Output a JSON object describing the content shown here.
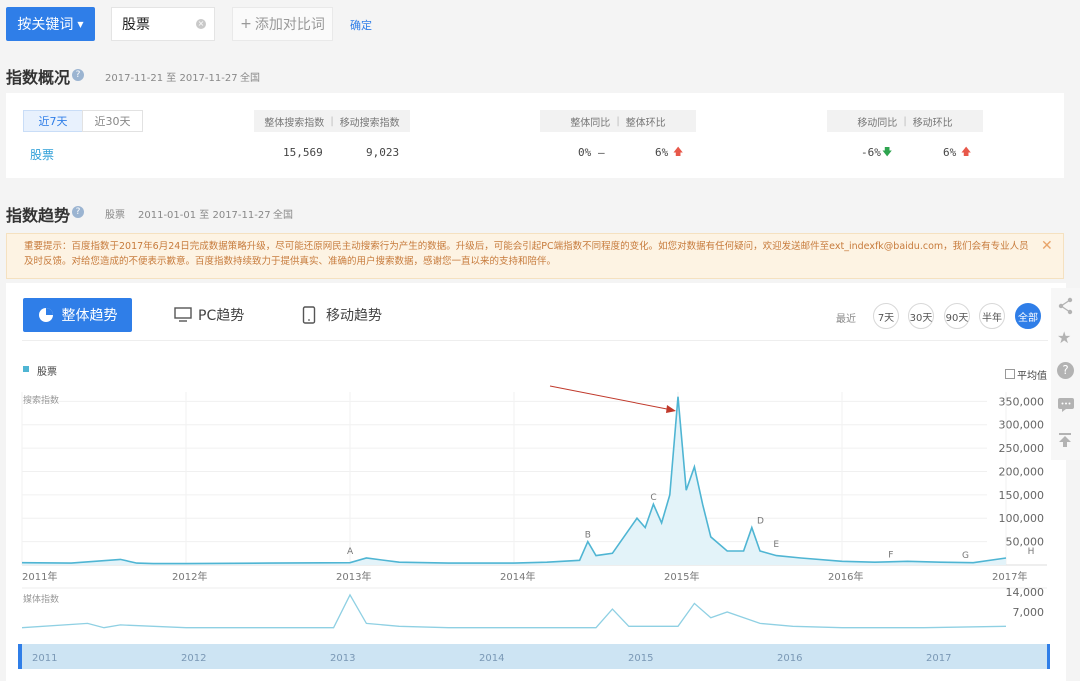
{
  "topbar": {
    "keyword_button": "按关键词",
    "keyword_value": "股票",
    "add_compare": "添加对比词",
    "confirm": "确定"
  },
  "overview": {
    "title": "指数概况",
    "date_range": "2017-11-21 至 2017-11-27",
    "region": "全国",
    "tabs": [
      "近7天",
      "近30天"
    ],
    "headers": {
      "search": [
        "整体搜索指数",
        "移动搜索指数"
      ],
      "overall": [
        "整体同比",
        "整体环比"
      ],
      "mobile": [
        "移动同比",
        "移动环比"
      ]
    },
    "row": {
      "keyword": "股票",
      "overall_search": "15,569",
      "mobile_search": "9,023",
      "overall_yoy": "0%",
      "overall_yoy_trend": "–",
      "overall_mom": "6%",
      "mobile_yoy": "-6%",
      "mobile_mom": "6%"
    }
  },
  "trend": {
    "title": "指数趋势",
    "keyword": "股票",
    "date_range": "2011-01-01 至 2017-11-27",
    "region": "全国",
    "notice": "重要提示：百度指数于2017年6月24日完成数据策略升级，尽可能还原网民主动搜索行为产生的数据。升级后，可能会引起PC端指数不同程度的变化。如您对数据有任何疑问，欢迎发送邮件至ext_indexfk@baidu.com，我们会有专业人员及时反馈。对给您造成的不便表示歉意。百度指数持续致力于提供真实、准确的用户搜索数据，感谢您一直以来的支持和陪伴。",
    "tabs": [
      "整体趋势",
      "PC趋势",
      "移动趋势"
    ],
    "range_label": "最近",
    "ranges": [
      "7天",
      "30天",
      "90天",
      "半年",
      "全部"
    ],
    "legend": "股票",
    "avg_label": "平均值",
    "search_axis_label": "搜索指数",
    "media_axis_label": "媒体指数"
  },
  "colors": {
    "accent": "#2f7ee8",
    "line": "#4fb5d3",
    "up": "#e8584a",
    "down": "#2ea44f",
    "annotation_arrow": "#c0392b"
  },
  "chart_data": [
    {
      "type": "area",
      "title": "",
      "ylabel": "搜索指数",
      "xlabel": "",
      "x_tick_labels": [
        "2011年",
        "2012年",
        "2013年",
        "2014年",
        "2015年",
        "2016年",
        "2017年"
      ],
      "y_tick_labels": [
        "50,000",
        "100,000",
        "150,000",
        "200,000",
        "250,000",
        "300,000",
        "350,000"
      ],
      "ylim": [
        0,
        370000
      ],
      "grid": true,
      "legend": "top-left",
      "series": [
        {
          "name": "股票",
          "x": [
            2011.0,
            2011.3,
            2011.6,
            2011.7,
            2011.8,
            2012.0,
            2012.5,
            2013.0,
            2013.1,
            2013.3,
            2013.6,
            2014.0,
            2014.2,
            2014.4,
            2014.45,
            2014.5,
            2014.6,
            2014.75,
            2014.8,
            2014.85,
            2014.9,
            2014.95,
            2015.0,
            2015.05,
            2015.1,
            2015.15,
            2015.2,
            2015.3,
            2015.4,
            2015.45,
            2015.5,
            2015.6,
            2015.75,
            2016.0,
            2016.2,
            2016.4,
            2016.6,
            2016.8,
            2017.0
          ],
          "values": [
            5000,
            4000,
            12000,
            4000,
            3000,
            3000,
            4000,
            5000,
            15000,
            6000,
            4000,
            4000,
            6000,
            10000,
            50000,
            20000,
            25000,
            100000,
            80000,
            130000,
            90000,
            150000,
            360000,
            160000,
            210000,
            130000,
            60000,
            30000,
            30000,
            80000,
            30000,
            20000,
            15000,
            8000,
            6000,
            8000,
            6000,
            5000,
            15000
          ]
        }
      ],
      "annotations": [
        "A",
        "B",
        "C",
        "D",
        "E",
        "F",
        "G",
        "H"
      ]
    },
    {
      "type": "line",
      "title": "",
      "ylabel": "媒体指数",
      "y_tick_labels": [
        "7,000",
        "14,000"
      ],
      "ylim": [
        0,
        14000
      ],
      "series": [
        {
          "name": "股票",
          "x": [
            2011.0,
            2011.4,
            2011.5,
            2011.6,
            2012.0,
            2012.5,
            2012.9,
            2013.0,
            2013.1,
            2013.3,
            2013.6,
            2014.0,
            2014.5,
            2014.6,
            2014.7,
            2014.8,
            2015.0,
            2015.1,
            2015.2,
            2015.3,
            2015.5,
            2015.7,
            2016.0,
            2016.5,
            2017.0
          ],
          "values": [
            1500,
            3000,
            1500,
            2500,
            1500,
            1500,
            1500,
            13000,
            3000,
            2000,
            1500,
            1500,
            1500,
            8000,
            2000,
            2000,
            2000,
            10000,
            5000,
            7000,
            3000,
            2000,
            1500,
            1500,
            2000
          ]
        }
      ]
    }
  ],
  "navigator": {
    "years": [
      "2011",
      "2012",
      "2013",
      "2014",
      "2015",
      "2016",
      "2017"
    ]
  }
}
